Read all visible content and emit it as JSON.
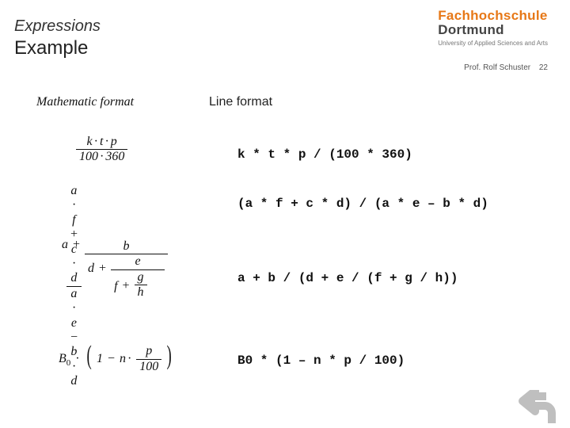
{
  "brand": {
    "line1": "Fachhochschule",
    "line2": "Dortmund",
    "tagline": "University of Applied Sciences and Arts"
  },
  "header": {
    "supertitle": "Expressions",
    "title": "Example"
  },
  "footer": {
    "author": "Prof. Rolf Schuster",
    "page": "22"
  },
  "columns": {
    "math_label": "Mathematic format",
    "line_label": "Line format"
  },
  "rows": {
    "r1": {
      "line": "k * t * p / (100 * 360)",
      "math": {
        "num_parts": [
          "k",
          "t",
          "p"
        ],
        "den_parts": [
          "100",
          "360"
        ]
      }
    },
    "r2": {
      "line": "(a * f + c * d) / (a * e – b * d)",
      "math": {
        "num": "a · f + c · d",
        "den": "a · e − b · d"
      }
    },
    "r3": {
      "line": "a + b / (d + e / (f + g / h))",
      "math": {
        "a": "a",
        "b": "b",
        "d": "d",
        "e": "e",
        "f": "f",
        "g": "g",
        "h": "h",
        "plus": "+"
      }
    },
    "r4": {
      "line": "B0 * (1 – n * p / 100)",
      "math": {
        "B": "B",
        "sub0": "0",
        "one": "1",
        "minus": "−",
        "n": "n",
        "p": "p",
        "hundred": "100"
      }
    }
  },
  "icons": {
    "undo_arrow": "undo-arrow"
  }
}
